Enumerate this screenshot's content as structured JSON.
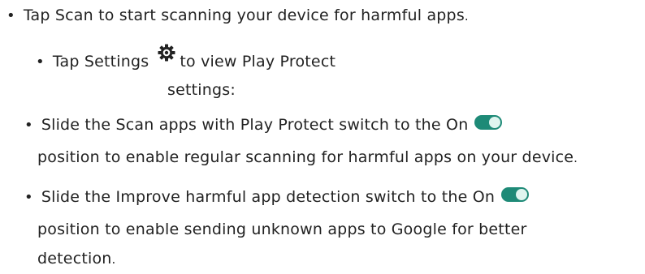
{
  "items": [
    {
      "bullet": "•",
      "text": "Tap Scan to start scanning your device for harmful apps",
      "period": "."
    },
    {
      "bullet": "•",
      "text_before": "Tap Settings",
      "text_after": "to view Play Protect",
      "continuation": "settings:"
    },
    {
      "bullet": "•",
      "text": "Slide the Scan apps with Play Protect switch to the On",
      "continuation": "position to enable regular scanning for harmful apps on your device",
      "period": "."
    },
    {
      "bullet": "•",
      "text": "Slide the Improve harmful app detection switch to the On",
      "continuation_1": "position to enable sending unknown apps to Google for better",
      "continuation_2": "detection",
      "period": "."
    }
  ],
  "icons": {
    "settings": "gear-icon",
    "switch": "toggle-switch-on-icon"
  },
  "colors": {
    "text": "#222222",
    "toggle_track": "#1e8a77",
    "toggle_knob": "#dff5ef"
  }
}
